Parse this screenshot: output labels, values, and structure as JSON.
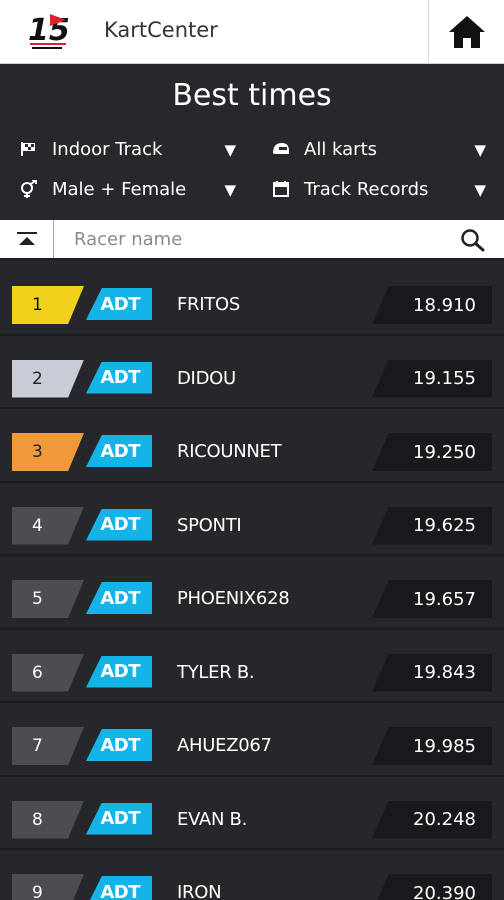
{
  "header": {
    "app_title": "KartCenter",
    "logo_text": "15"
  },
  "page": {
    "title": "Best times"
  },
  "filters": {
    "track": "Indoor Track",
    "karts": "All karts",
    "gender": "Male + Female",
    "period": "Track Records",
    "caret": "▼"
  },
  "search": {
    "placeholder": "Racer name"
  },
  "colors": {
    "gold": "#f2d11c",
    "silver": "#c9cbd6",
    "bronze": "#f0993a",
    "default_rank": "#4b4d52",
    "kart_badge": "#14b4e8",
    "background": "#25272b"
  },
  "ranking": [
    {
      "rank": "1",
      "kart": "ADT",
      "racer": "FRITOS",
      "time": "18.910"
    },
    {
      "rank": "2",
      "kart": "ADT",
      "racer": "DIDOU",
      "time": "19.155"
    },
    {
      "rank": "3",
      "kart": "ADT",
      "racer": "RICOUNNET",
      "time": "19.250"
    },
    {
      "rank": "4",
      "kart": "ADT",
      "racer": "SPONTI",
      "time": "19.625"
    },
    {
      "rank": "5",
      "kart": "ADT",
      "racer": "PHOENIX628",
      "time": "19.657"
    },
    {
      "rank": "6",
      "kart": "ADT",
      "racer": "TYLER B.",
      "time": "19.843"
    },
    {
      "rank": "7",
      "kart": "ADT",
      "racer": "AHUEZ067",
      "time": "19.985"
    },
    {
      "rank": "8",
      "kart": "ADT",
      "racer": "EVAN B.",
      "time": "20.248"
    },
    {
      "rank": "9",
      "kart": "ADT",
      "racer": "IRON",
      "time": "20.390"
    }
  ]
}
